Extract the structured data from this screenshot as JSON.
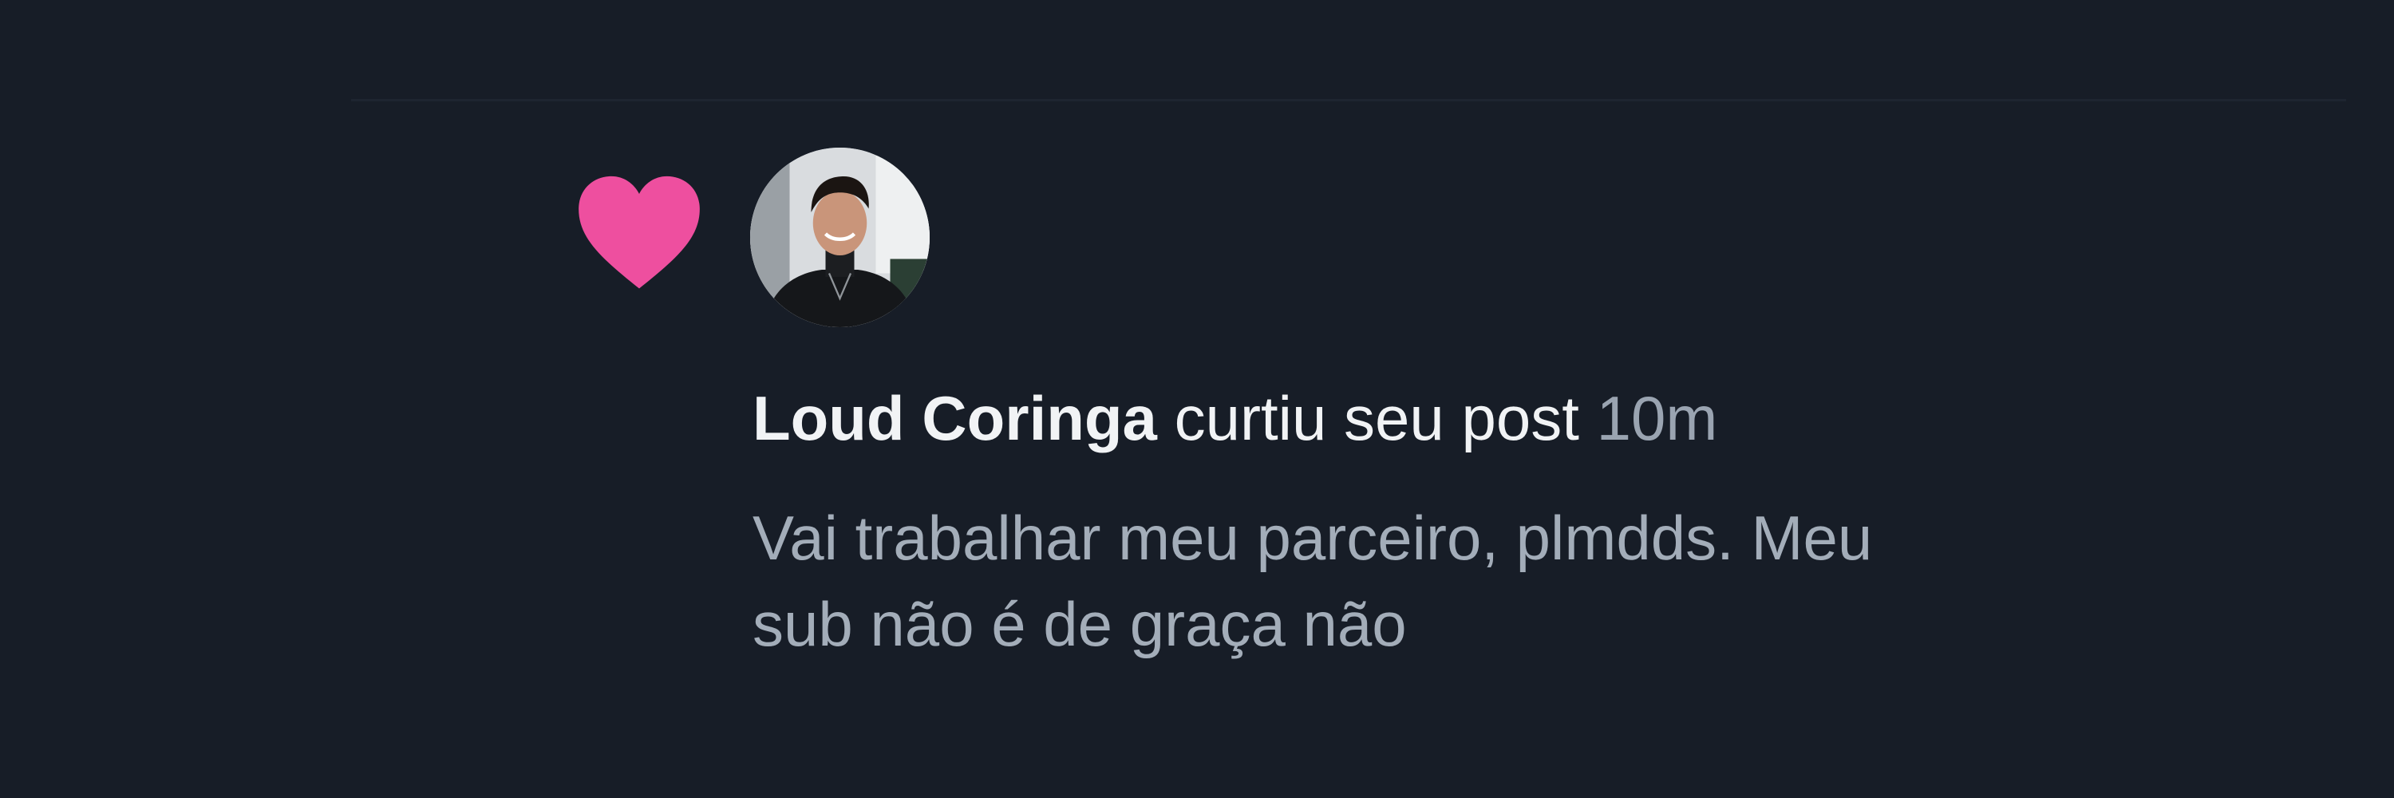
{
  "notification": {
    "user_name": "Loud Coringa",
    "action": "curtiu seu post",
    "timestamp": "10m",
    "comment_line1": "Vai trabalhar meu parceiro, plmdds. Meu",
    "comment_line2": "sub não é de graça não",
    "icon": "heart-icon",
    "accent_color": "#ee4f9f"
  }
}
